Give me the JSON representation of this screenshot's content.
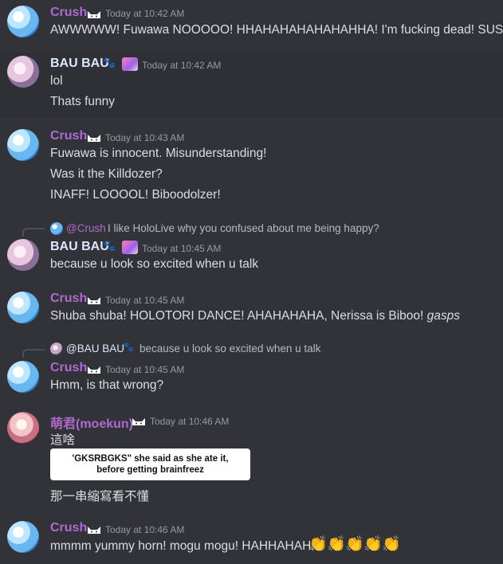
{
  "colors": {
    "background": "#313338",
    "hover_background": "#2e3035",
    "crush_name": "#b069d1",
    "bau_name": "#dfe7ff",
    "moe_name": "#b069d1",
    "timestamp": "#949ba4",
    "message_text": "#dbdee1"
  },
  "messages": {
    "m1": {
      "author": "Crush",
      "avatar_icon": "crush-avatar",
      "badges": [
        "cat-icon"
      ],
      "timestamp": "Today at 10:42 AM",
      "lines": [
        "AWWWWW! Fuwawa NOOOOO! HHAHAHAHAHAHAHHA! I'm fucking dead! SUS!"
      ]
    },
    "m2": {
      "author": "BAU BAU",
      "avatar_icon": "bau-avatar",
      "badges": [
        "paw-icon",
        "anime-badge-icon"
      ],
      "timestamp": "Today at 10:42 AM",
      "lines": [
        "lol",
        "Thats funny"
      ]
    },
    "m3": {
      "author": "Crush",
      "avatar_icon": "crush-avatar",
      "badges": [
        "cat-icon"
      ],
      "timestamp": "Today at 10:43 AM",
      "lines": [
        "Fuwawa is innocent. Misunderstanding!",
        "Was it the Killdozer?",
        "INAFF! LOOOOL! Biboodolzer!"
      ]
    },
    "m4": {
      "reply": {
        "author": "@Crush",
        "text": "I like HoloLive why you confused about me being happy?"
      },
      "author": "BAU BAU",
      "avatar_icon": "bau-avatar",
      "badges": [
        "paw-icon",
        "anime-badge-icon"
      ],
      "timestamp": "Today at 10:45 AM",
      "lines": [
        "because u look so excited when u talk"
      ]
    },
    "m5": {
      "author": "Crush",
      "avatar_icon": "crush-avatar",
      "badges": [
        "cat-icon"
      ],
      "timestamp": "Today at 10:45 AM",
      "line_plain": "Shuba shuba! HOLOTORI DANCE! AHAHAHAHA, Nerissa is Biboo! ",
      "line_italic": "gasps"
    },
    "m6": {
      "reply": {
        "author": "@BAU BAU",
        "text": "because u look so excited when u talk"
      },
      "author": "Crush",
      "avatar_icon": "crush-avatar",
      "badges": [
        "cat-icon"
      ],
      "timestamp": "Today at 10:45 AM",
      "lines": [
        "Hmm, is that wrong?"
      ]
    },
    "m7": {
      "author": "萌君(moekun)",
      "avatar_icon": "moe-avatar",
      "badges": [
        "cat-icon"
      ],
      "timestamp": "Today at 10:46 AM",
      "line1": "這啥",
      "embed": [
        "'GKSRBGKS\" she said as she ate it,",
        "before getting brainfreez"
      ],
      "line2": "那一串縮寫看不懂"
    },
    "m8": {
      "author": "Crush",
      "avatar_icon": "crush-avatar",
      "badges": [
        "cat-icon"
      ],
      "timestamp": "Today at 10:46 AM",
      "line": "mmmm yummy horn! mogu mogu! HAHHAHAH!",
      "emoji": "👏",
      "emoji_count": 5
    }
  }
}
